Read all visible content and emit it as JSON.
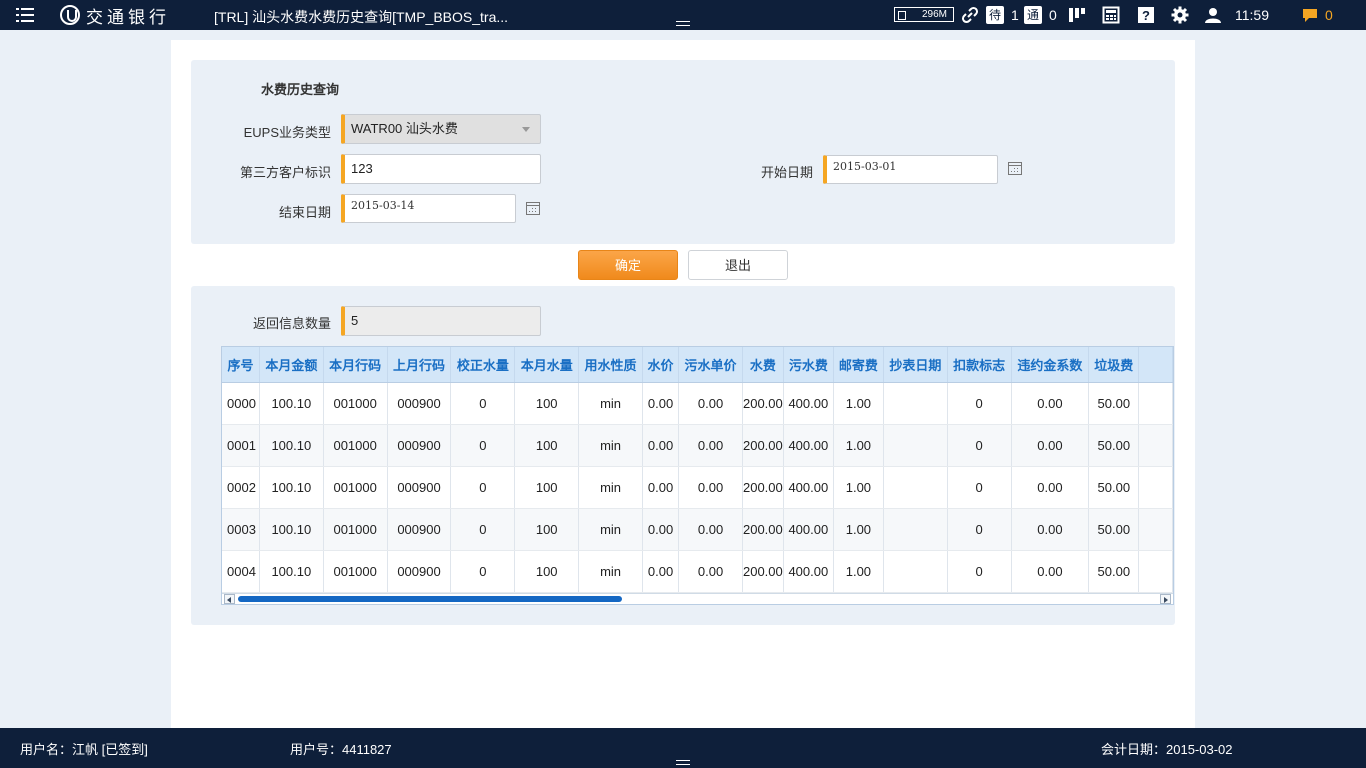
{
  "header": {
    "logo_text": "交通银行",
    "window_title": "[TRL] 汕头水费水费历史查询[TMP_BBOS_tra...",
    "memory": "296M",
    "pending_label": "待",
    "pending_count": "1",
    "notify_label": "通",
    "notify_count": "0",
    "time": "11:59",
    "message_count": "0"
  },
  "query": {
    "title": "水费历史查询",
    "business_type_label": "EUPS业务类型",
    "business_type_value": "WATR00 汕头水费",
    "customer_id_label": "第三方客户标识",
    "customer_id_value": "123",
    "start_date_label": "开始日期",
    "start_date_value": "2015-03-01",
    "end_date_label": "结束日期",
    "end_date_value": "2015-03-14"
  },
  "buttons": {
    "confirm": "确定",
    "exit": "退出"
  },
  "result": {
    "count_label": "返回信息数量",
    "count_value": "5",
    "columns": [
      "序号",
      "本月金额",
      "本月行码",
      "上月行码",
      "校正水量",
      "本月水量",
      "用水性质",
      "水价",
      "污水单价",
      "水费",
      "污水费",
      "邮寄费",
      "抄表日期",
      "扣款标志",
      "违约金系数",
      "垃圾费"
    ],
    "rows": [
      [
        "0000",
        "100.10",
        "001000",
        "000900",
        "0",
        "100",
        "min",
        "0.00",
        "0.00",
        "200.00",
        "400.00",
        "1.00",
        "",
        "0",
        "0.00",
        "50.00"
      ],
      [
        "0001",
        "100.10",
        "001000",
        "000900",
        "0",
        "100",
        "min",
        "0.00",
        "0.00",
        "200.00",
        "400.00",
        "1.00",
        "",
        "0",
        "0.00",
        "50.00"
      ],
      [
        "0002",
        "100.10",
        "001000",
        "000900",
        "0",
        "100",
        "min",
        "0.00",
        "0.00",
        "200.00",
        "400.00",
        "1.00",
        "",
        "0",
        "0.00",
        "50.00"
      ],
      [
        "0003",
        "100.10",
        "001000",
        "000900",
        "0",
        "100",
        "min",
        "0.00",
        "0.00",
        "200.00",
        "400.00",
        "1.00",
        "",
        "0",
        "0.00",
        "50.00"
      ],
      [
        "0004",
        "100.10",
        "001000",
        "000900",
        "0",
        "100",
        "min",
        "0.00",
        "0.00",
        "200.00",
        "400.00",
        "1.00",
        "",
        "0",
        "0.00",
        "50.00"
      ]
    ]
  },
  "footer": {
    "user_name": "用户名：江帆 [已签到]",
    "user_id": "用户号：4411827",
    "accounting_date": "会计日期：2015-03-02"
  }
}
